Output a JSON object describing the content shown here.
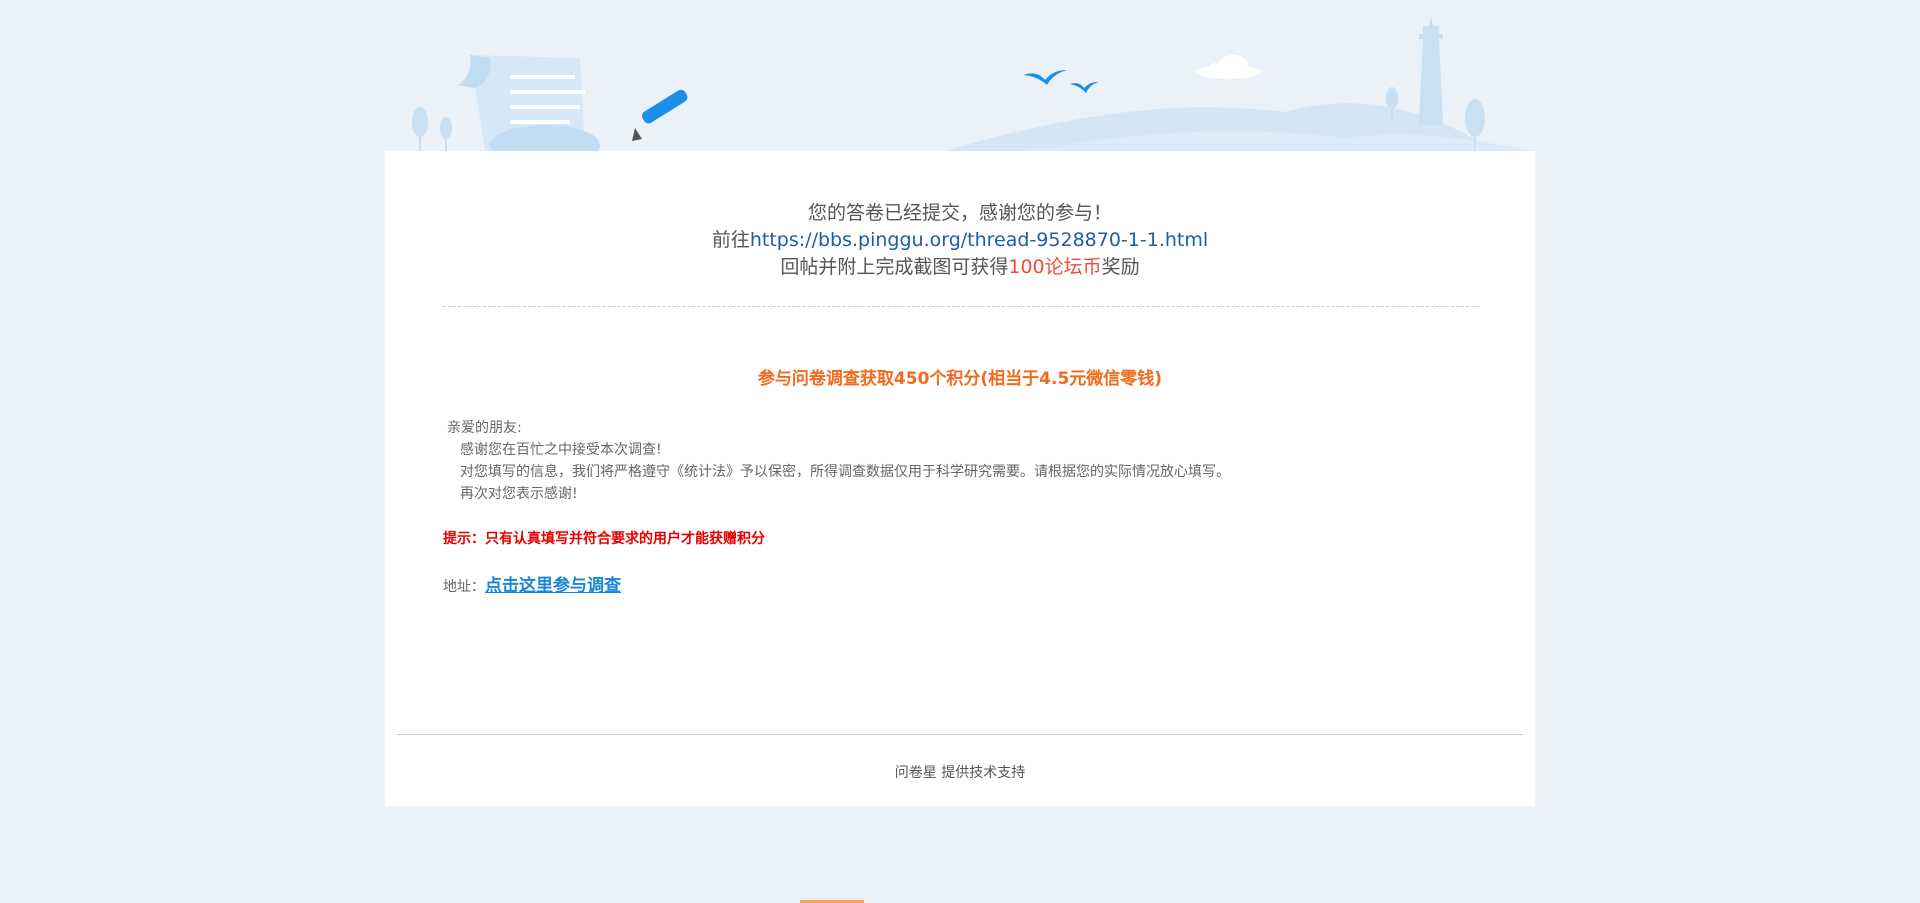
{
  "submission": {
    "line1": "您的答卷已经提交，感谢您的参与！",
    "line2_prefix": "前往",
    "line2_link": "https://bbs.pinggu.org/thread-9528870-1-1.html",
    "line3_prefix": "回帖并附上完成截图可获得",
    "line3_reward": "100论坛币",
    "line3_suffix": "奖励"
  },
  "survey": {
    "title": "参与问卷调查获取450个积分(相当于4.5元微信零钱)",
    "greeting": "亲爱的朋友:",
    "body_lines": [
      "感谢您在百忙之中接受本次调查!",
      "对您填写的信息，我们将严格遵守《统计法》予以保密，所得调查数据仅用于科学研究需要。请根据您的实际情况放心填写。",
      "再次对您表示感谢!"
    ],
    "hint": "提示：只有认真填写并符合要求的用户才能获赠积分",
    "address_label": "地址：",
    "address_link": "点击这里参与调查"
  },
  "footer": {
    "brand": "问卷星",
    "text": "提供技术支持"
  },
  "colors": {
    "page_background": "#eaf1f8",
    "link": "#1a5fa8",
    "reward": "#f24a3c",
    "title_orange": "#f26a1b",
    "hint_red": "#e60000",
    "survey_link": "#1787d6"
  }
}
